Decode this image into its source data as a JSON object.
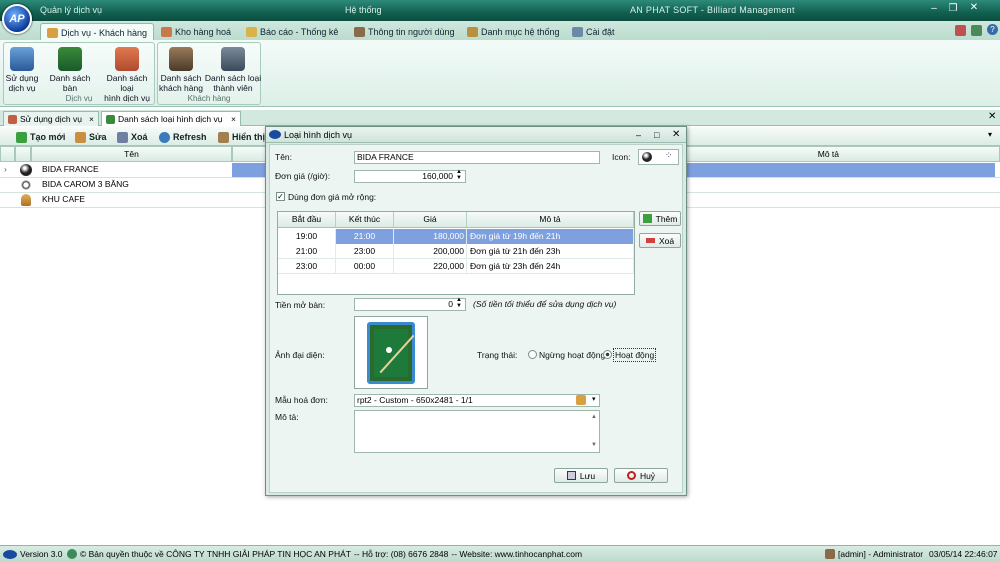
{
  "titlebar": {
    "app_section": "Quản lý dịch vụ",
    "sys_section": "Hệ thống",
    "app_title": "AN PHAT SOFT - Billiard Management",
    "logo": "AP"
  },
  "ribbon_tabs": [
    {
      "label": "Dịch vụ - Khách hàng",
      "icon": "service-icon",
      "active": true
    },
    {
      "label": "Kho hàng hoá",
      "icon": "warehouse-icon"
    },
    {
      "label": "Báo cáo - Thống kê",
      "icon": "report-icon"
    },
    {
      "label": "Thông tin người dùng",
      "icon": "user-info-icon"
    },
    {
      "label": "Danh mục hệ thống",
      "icon": "catalog-icon"
    },
    {
      "label": "Cài đặt",
      "icon": "settings-icon"
    }
  ],
  "ribbon_groups": {
    "service": {
      "caption": "Dịch vụ",
      "buttons": [
        {
          "label1": "Sử dụng",
          "label2": "dịch vụ"
        },
        {
          "label1": "Danh sách bàn",
          "label2": ""
        },
        {
          "label1": "Danh sách loại",
          "label2": "hình dịch vụ"
        }
      ]
    },
    "customer": {
      "caption": "Khách hàng",
      "buttons": [
        {
          "label1": "Danh sách",
          "label2": "khách hàng"
        },
        {
          "label1": "Danh sách loại",
          "label2": "thành viên"
        }
      ]
    }
  },
  "doc_tabs": [
    {
      "label": "Sử dụng dịch vụ",
      "close": "×"
    },
    {
      "label": "Danh sách loại hình dịch vụ",
      "close": "×"
    }
  ],
  "toolbar": {
    "new": "Tạo mới",
    "edit": "Sửa",
    "delete": "Xoá",
    "refresh": "Refresh",
    "show": "Hiển thị"
  },
  "grid": {
    "col_name": "Tên",
    "col_desc": "Mô tả",
    "rows": [
      {
        "name": "BIDA FRANCE",
        "icon": "billiard-ball-icon"
      },
      {
        "name": "BIDA CAROM 3 BĂNG",
        "icon": "soccer-ball-icon"
      },
      {
        "name": "KHU CAFE",
        "icon": "person-icon"
      }
    ]
  },
  "dialog": {
    "title": "Loại hình dịch vụ",
    "name_label": "Tên:",
    "name_value": "BIDA FRANCE",
    "icon_label": "Icon:",
    "price_label": "Đơn giá (/giờ):",
    "price_value": "160,000",
    "ext_price_label": "Dùng đơn giá mở rộng:",
    "table": {
      "headers": [
        "Bắt đầu",
        "Kết thúc",
        "Giá",
        "Mô tả"
      ],
      "rows": [
        [
          "19:00",
          "21:00",
          "180,000",
          "Đơn giá từ 19h đến 21h"
        ],
        [
          "21:00",
          "23:00",
          "200,000",
          "Đơn giá từ 21h đến 23h"
        ],
        [
          "23:00",
          "00:00",
          "220,000",
          "Đơn giá từ 23h đến 24h"
        ]
      ]
    },
    "add_button": "Thêm",
    "remove_button": "Xoá",
    "open_fee_label": "Tiền mở bàn:",
    "open_fee_value": "0",
    "open_fee_hint": "(Số tiền tối thiểu để sửa dụng dịch vụ)",
    "avatar_label": "Ảnh đại diện:",
    "status_label": "Trạng thái:",
    "status_inactive": "Ngừng hoạt động",
    "status_active": "Hoạt động",
    "invoice_label": "Mẫu hoá đơn:",
    "invoice_value": "rpt2 - Custom - 650x2481 - 1/1",
    "desc_label": "Mô tả:",
    "save_button": "Lưu",
    "cancel_button": "Huỷ"
  },
  "statusbar": {
    "version": "Version 3.0",
    "copyright": "© Bản quyền thuộc về CÔNG TY TNHH GIẢI PHÁP TIN HỌC AN PHÁT",
    "support": "-- Hỗ trợ: (08) 6676 2848",
    "website": "-- Website: www.tinhocanphat.com",
    "user": "[admin] - Administrator",
    "datetime": "03/05/14 22:46:07"
  },
  "colors": {
    "accent": "#11604f",
    "selection": "#7ea0de",
    "ribbon_bg": "#dcefe7"
  }
}
